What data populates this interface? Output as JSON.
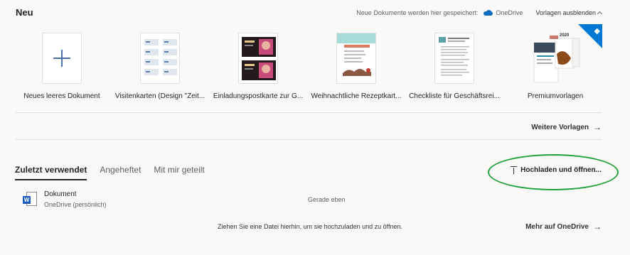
{
  "header": {
    "title": "Neu",
    "save_location_text": "Neue Dokumente werden hier gespeichert:",
    "save_location": "OneDrive",
    "hide_templates": "Vorlagen ausblenden"
  },
  "templates": [
    {
      "label": "Neues leeres Dokument"
    },
    {
      "label": "Visitenkarten (Design \"Zeit..."
    },
    {
      "label": "Einladungspostkarte zur G..."
    },
    {
      "label": "Weihnachtliche Rezeptkart..."
    },
    {
      "label": "Checkliste für Geschäftsrei..."
    },
    {
      "label": "Premiumvorlagen",
      "premium_year": "2020"
    }
  ],
  "more_templates": "Weitere Vorlagen",
  "tabs": [
    {
      "label": "Zuletzt verwendet",
      "active": true
    },
    {
      "label": "Angeheftet",
      "active": false
    },
    {
      "label": "Mit mir geteilt",
      "active": false
    }
  ],
  "upload": {
    "label": "Hochladen und öffnen..."
  },
  "files": [
    {
      "name": "Dokument",
      "location": "OneDrive (persönlich)",
      "time": "Gerade eben",
      "app_badge": "W"
    }
  ],
  "drop_hint": "Ziehen Sie eine Datei hierhin, um sie hochzuladen und zu öffnen.",
  "more_onedrive": "Mehr auf OneDrive",
  "colors": {
    "accent": "#0078d4",
    "highlight_oval": "#1fa13a",
    "word_blue": "#185abd"
  }
}
